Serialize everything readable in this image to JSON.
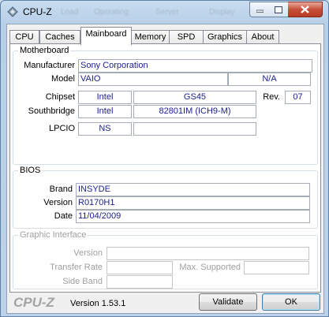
{
  "window": {
    "title": "CPU-Z",
    "ghost_texts": [
      "Load",
      "Operating",
      "Server",
      "Display"
    ]
  },
  "tabs": [
    "CPU",
    "Caches",
    "Mainboard",
    "Memory",
    "SPD",
    "Graphics",
    "About"
  ],
  "active_tab": "Mainboard",
  "motherboard": {
    "group_label": "Motherboard",
    "manufacturer_label": "Manufacturer",
    "manufacturer": "Sony Corporation",
    "model_label": "Model",
    "model": "VAIO",
    "model_rev": "N/A",
    "chipset_label": "Chipset",
    "chipset_vendor": "Intel",
    "chipset_name": "GS45",
    "rev_label": "Rev.",
    "chipset_rev": "07",
    "southbridge_label": "Southbridge",
    "southbridge_vendor": "Intel",
    "southbridge_name": "82801IM (ICH9-M)",
    "lpcio_label": "LPCIO",
    "lpcio_vendor": "NS"
  },
  "bios": {
    "group_label": "BIOS",
    "brand_label": "Brand",
    "brand": "INSYDE",
    "version_label": "Version",
    "version": "R0170H1",
    "date_label": "Date",
    "date": "11/04/2009"
  },
  "graphic_interface": {
    "group_label": "Graphic Interface",
    "version_label": "Version",
    "transfer_rate_label": "Transfer Rate",
    "max_supported_label": "Max. Supported",
    "side_band_label": "Side Band"
  },
  "footer": {
    "logo": "CPU-Z",
    "version": "Version 1.53.1",
    "validate_label": "Validate",
    "ok_label": "OK"
  },
  "colors": {
    "value_text": "#1a1f8c",
    "titlebar": "#c9dcef",
    "close_button": "#c7503a"
  }
}
